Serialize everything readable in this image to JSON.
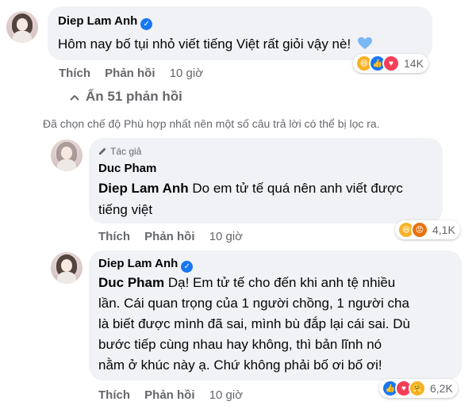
{
  "comment1": {
    "name": "Diep Lam Anh",
    "text": "Hôm nay bố tụi nhỏ viết tiếng Việt rất giỏi vậy nè!",
    "like": "Thích",
    "reply": "Phản hồi",
    "time": "10 giờ",
    "reaction_count": "14K"
  },
  "hide_replies": "Ẩn 51 phản hồi",
  "filter_note": "Đã chọn chế độ Phù hợp nhất nên một số câu trả lời có thể bị lọc ra.",
  "reply1": {
    "badge": "Tác giả",
    "name": "Duc Pham",
    "tag": "Diep Lam Anh",
    "text_line1": "Do em tử tế quá nên anh viết được",
    "text_line2": "tiếng việt",
    "like": "Thích",
    "reply": "Phản hồi",
    "time": "10 giờ",
    "reaction_count": "4,1K"
  },
  "reply2": {
    "name": "Diep Lam Anh",
    "tag": "Duc Pham",
    "line1": "Dạ! Em tử tế cho đến khi anh tệ nhiều",
    "line2": "lần. Cái quan trọng của 1 người chồng, 1 người cha",
    "line3": "là biết được mình đã sai, mình bù đắp lại cái sai. Dù",
    "line4": "bước tiếp cùng nhau hay không, thì bản lĩnh nó",
    "line5": "nằm ở khúc này ạ. Chứ không phải bố ơi bố ơi!",
    "like": "Thích",
    "reply": "Phản hồi",
    "time": "10 giờ",
    "reaction_count": "6,2K"
  },
  "colors": {
    "secondary": "#65676b",
    "bubble": "#f0f2f5",
    "brand": "#1877f2"
  }
}
